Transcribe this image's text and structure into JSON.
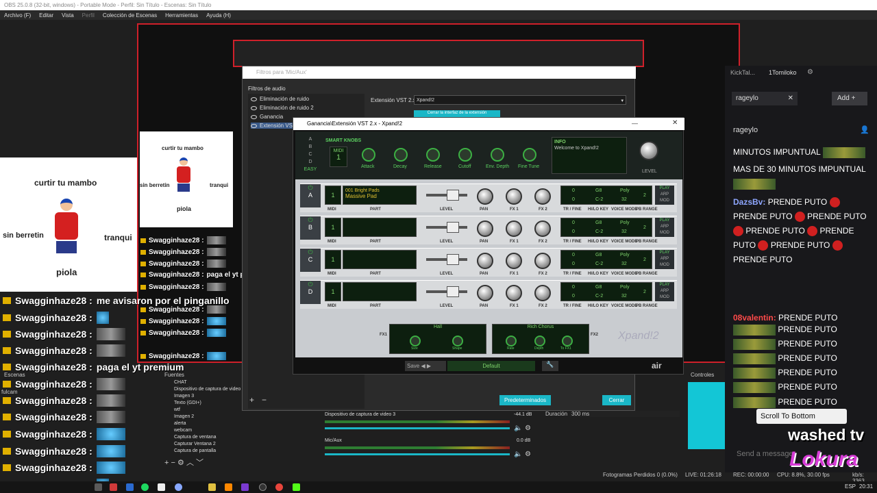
{
  "obs": {
    "title": "OBS 25.0.8 (32-bit, windows) - Portable Mode - Perfil: Sin Título - Escenas: Sin Título",
    "menu": [
      "Archivo (F)",
      "Editar",
      "Vista",
      "Perfil",
      "Colección de Escenas",
      "Herramientas",
      "Ayuda (H)"
    ],
    "scenes_label": "Escenas",
    "sources_label": "Fuentes",
    "sources": [
      "CHAT",
      "Dispositivo de captura de video",
      "Imagen 3",
      "Texto (GDI+)",
      "wtf",
      "Imagen 2",
      "alerta",
      "webcam",
      "Captura de ventana",
      "Capturar Ventana 2",
      "Captura de pantalla"
    ],
    "scene_item": "fulcam",
    "mixer": [
      {
        "name": "Dispositivo de captura de video 3",
        "level": "-44.1 dB"
      },
      {
        "name": "Mic/Aux",
        "level": "0.0 dB"
      }
    ],
    "duration_label": "Duración",
    "duration_value": "300 ms",
    "controls_label": "Controles",
    "status": {
      "dropped": "Fotogramas Perdidos 0 (0.0%)",
      "live": "LIVE: 01:26:18",
      "rec": "REC: 00:00:00",
      "cpu": "CPU: 8.8%, 30.00 fps",
      "kbps": "kb/s: 3363"
    }
  },
  "filters_dialog": {
    "title": "Filtros para 'Mic/Aux'",
    "section": "Filtros de audio",
    "items": [
      "Eliminación de ruido",
      "Eliminación de ruido 2",
      "Ganancia",
      "Extensión VST"
    ],
    "vst_label": "Extensión VST 2.x",
    "vst_value": "Xpand!2",
    "open_interface": "Cerrar la interfaz de la extensión",
    "defaults_button": "Predeterminados",
    "close_button": "Cerrar"
  },
  "vst": {
    "title": "Ganancia\\Extensión VST 2.x - Xpand!2",
    "smart_knobs": "SMART KNOBS",
    "midi_label": "MIDI",
    "midi_value": "1",
    "easy": "EASY",
    "letters": [
      "A",
      "B",
      "C",
      "D"
    ],
    "knobs": [
      "Attack",
      "Decay",
      "Release",
      "Cutoff",
      "Env. Depth",
      "Fine Tune"
    ],
    "info_label": "INFO",
    "info_text": "Welcome to Xpand!2",
    "level_label": "LEVEL",
    "parts": [
      {
        "letter": "A",
        "patch_num": "001 Bright Pads",
        "patch": "Massive Pad"
      },
      {
        "letter": "B",
        "patch_num": "",
        "patch": ""
      },
      {
        "letter": "C",
        "patch_num": "",
        "patch": ""
      },
      {
        "letter": "D",
        "patch_num": "",
        "patch": ""
      }
    ],
    "part_labels": {
      "midi": "MIDI",
      "part": "PART",
      "level": "LEVEL",
      "pan": "PAN",
      "fx1": "FX 1",
      "fx2": "FX 2",
      "trfine": "TR / FINE",
      "hilo": "HI/LO KEY",
      "voicemode": "VOICE MODE",
      "pbrange": "PB RANGE"
    },
    "part_values": {
      "tr": "0",
      "fine": "0",
      "hi": "G8",
      "lo": "C-2",
      "mode": "Poly",
      "voices": "32",
      "pb": "2",
      "play": "PLAY",
      "arp": "ARP",
      "mod": "MOD"
    },
    "fx1_name": "Hall",
    "fx2_name": "Rich Chorus",
    "fx1_knobs": [
      "Size",
      "Shape"
    ],
    "fx2_knobs": [
      "Rate",
      "Depth",
      "To FX1"
    ],
    "fx1": "FX1",
    "fx2": "FX2",
    "brand": "Xpand!2",
    "save": "Save",
    "preset": "Default",
    "air": "air"
  },
  "chat_left": {
    "user": "Swagginhaze28 :",
    "line1": "me avisaron por el pinganillo",
    "line2": "paga el yt premium"
  },
  "meme": {
    "top": "curtir tu mambo",
    "left": "sin berretin",
    "right": "tranqui",
    "bottom": "piola"
  },
  "right_chat": {
    "tab1": "KickTal...",
    "tab2": "1Tomiloko",
    "search_user": "rageylo",
    "add_button": "Add",
    "channel": "rageylo",
    "msg1": "MINUTOS IMPUNTUAL",
    "msg2": "MAS DE 30 MINUTOS IMPUNTUAL",
    "user2": "DazsBv:",
    "prende": "PRENDE PUTO",
    "user3": "08valentin:",
    "scroll_button": "Scroll To Bottom",
    "send_placeholder": "Send a message",
    "washed": "washed tv",
    "lokura": "Lokura"
  },
  "taskbar": {
    "time": "20:31",
    "lang": "ESP"
  }
}
